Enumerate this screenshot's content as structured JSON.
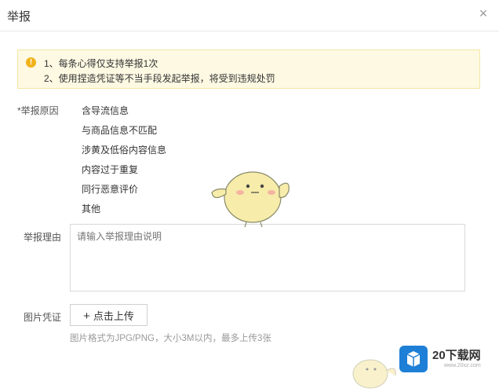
{
  "dialog": {
    "title": "举报",
    "close_glyph": "×"
  },
  "notice": {
    "icon_glyph": "!",
    "lines": [
      "1、每条心得仅支持举报1次",
      "2、使用捏造凭证等不当手段发起举报，将受到违规处罚"
    ]
  },
  "reason": {
    "label": "*举报原因",
    "options": [
      "含导流信息",
      "与商品信息不匹配",
      "涉黄及低俗内容信息",
      "内容过于重复",
      "同行恶意评价",
      "其他"
    ]
  },
  "explain": {
    "label": "举报理由",
    "placeholder": "请输入举报理由说明"
  },
  "proof": {
    "label": "图片凭证",
    "upload_plus": "+",
    "upload_label": "点击上传",
    "hint": "图片格式为JPG/PNG，大小3M以内，最多上传3张"
  },
  "watermark": {
    "brand": "20下载网",
    "url": "www.20xz.com"
  },
  "colors": {
    "notice_bg": "#fdf9e3",
    "notice_icon": "#f2b21a",
    "watermark_blue": "#1e7fd6"
  }
}
